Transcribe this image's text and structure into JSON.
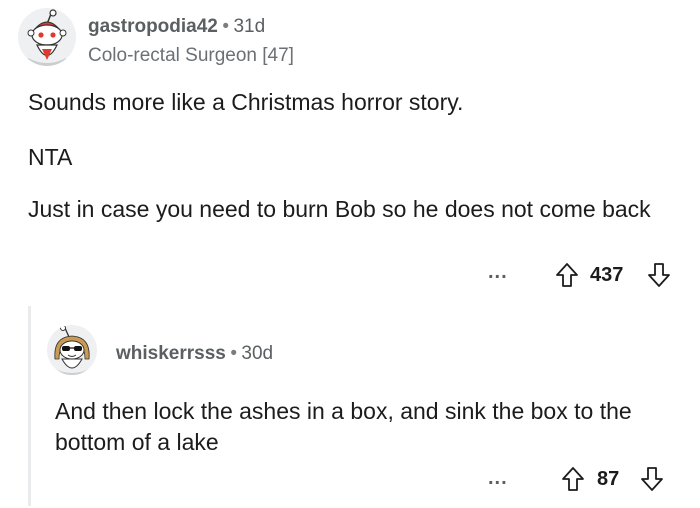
{
  "comment": {
    "username": "gastropodia42",
    "separator": "•",
    "age": "31d",
    "flair": "Colo-rectal Surgeon [47]",
    "paragraphs": [
      "Sounds more like a Christmas horror story.",
      "NTA",
      "Just in case you need to burn Bob so he does not come back"
    ],
    "more_label": "...",
    "score": "437"
  },
  "reply": {
    "username": "whiskerrsss",
    "separator": "•",
    "age": "30d",
    "text": "And then lock the ashes in a box, and sink the box to the bottom of a lake",
    "more_label": "...",
    "score": "87"
  },
  "icons": [
    "avatar-snoo-icon",
    "avatar-snoo-sunglasses-icon",
    "upvote-icon",
    "downvote-icon",
    "more-icon"
  ],
  "colors": {
    "text": "#1c1c1c",
    "meta": "#5a5f62",
    "thread_line": "#e9ebed",
    "snoo_red": "#e03a2f"
  }
}
